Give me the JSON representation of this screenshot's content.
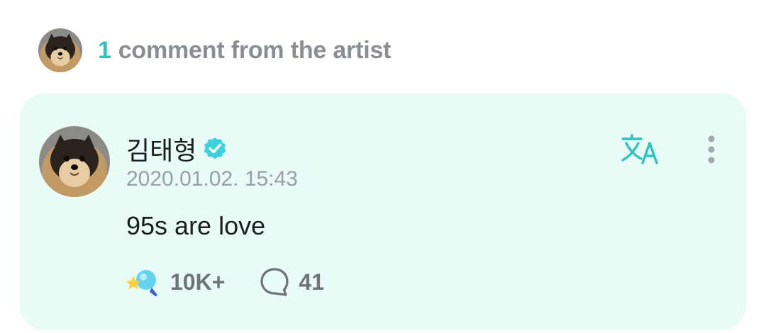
{
  "header": {
    "count": "1",
    "label": "comment from the artist"
  },
  "comment": {
    "author": "김태형",
    "verified": true,
    "timestamp": "2020.01.02. 15:43",
    "text": "95s are love",
    "cheers": "10K+",
    "replies": "41"
  },
  "icons": {
    "avatar": "pomeranian-dog-photo",
    "verified": "verified-badge-icon",
    "translate": "translate-icon",
    "more": "more-vertical-icon",
    "cheer": "cheer-icon",
    "reply": "reply-bubble-icon"
  },
  "colors": {
    "accent": "#2ec4be",
    "card_background": "#e8fbf7",
    "verified": "#3ad1dc",
    "muted_text": "#8a8e92"
  }
}
